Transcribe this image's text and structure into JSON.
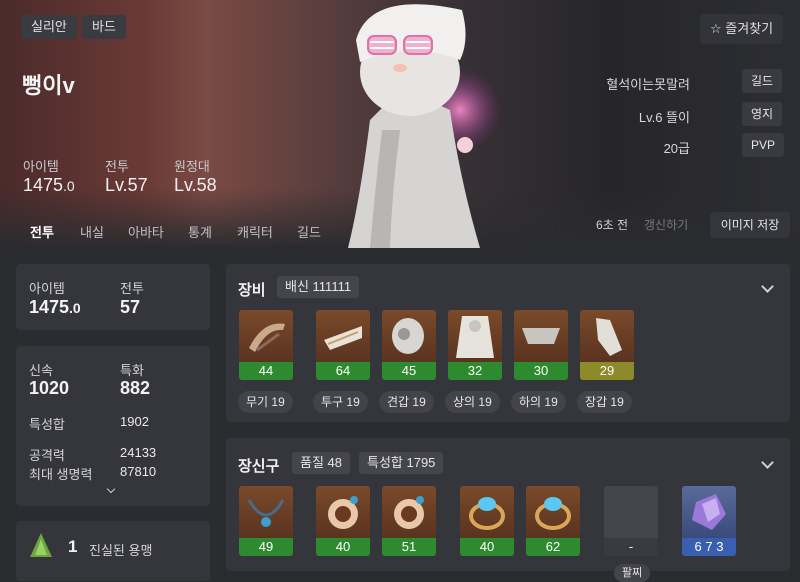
{
  "header": {
    "class_tag": "실리안",
    "class_tag2": "바드",
    "name": "뻥이v",
    "stats": [
      {
        "label": "아이템",
        "value": "1475",
        "decimal": ".0"
      },
      {
        "label": "전투",
        "value": "Lv.57",
        "decimal": ""
      },
      {
        "label": "원정대",
        "value": "Lv.58",
        "decimal": ""
      }
    ],
    "favorite_label": "즐겨찾기",
    "guild_name": "혈석이는못말려",
    "guild_badge": "길드",
    "estate_name": "Lv.6 뜰이",
    "estate_badge": "영지",
    "pvp_rank": "20급",
    "pvp_badge": "PVP"
  },
  "tabs": [
    "전투",
    "내실",
    "아바타",
    "통계",
    "캐릭터",
    "길드"
  ],
  "refresh": {
    "time": "6초 전",
    "label": "갱신하기",
    "save_label": "이미지 저장"
  },
  "summary": {
    "item_label": "아이템",
    "item_value": "1475",
    "item_decimal": ".0",
    "combat_label": "전투",
    "combat_value": "57"
  },
  "attributes": {
    "swift_label": "신속",
    "swift_value": "1020",
    "crit_label": "특화",
    "crit_value": "882",
    "sum_label": "특성합",
    "sum_value": "1902",
    "atk_label": "공격력",
    "atk_value": "24133",
    "hp_label": "최대 생명력",
    "hp_value": "87810"
  },
  "engraving": {
    "count": "1",
    "name": "진실된 용맹"
  },
  "equipment": {
    "title": "장비",
    "badge": "배신 111111",
    "items": [
      {
        "icon": "weapon-icon",
        "quality": "44",
        "label": "무기 19"
      },
      {
        "icon": "helmet-icon",
        "quality": "64",
        "label": "투구 19"
      },
      {
        "icon": "shoulder-icon",
        "quality": "45",
        "label": "견갑 19"
      },
      {
        "icon": "chest-icon",
        "quality": "32",
        "label": "상의 19"
      },
      {
        "icon": "pants-icon",
        "quality": "30",
        "label": "하의 19"
      },
      {
        "icon": "gloves-icon",
        "quality": "29",
        "label": "장갑 19"
      }
    ]
  },
  "accessories": {
    "title": "장신구",
    "badge1": "품질 48",
    "badge2": "특성합 1795",
    "items": [
      {
        "icon": "necklace-icon",
        "quality": "49"
      },
      {
        "icon": "earring-icon",
        "quality": "40"
      },
      {
        "icon": "earring-icon",
        "quality": "51"
      },
      {
        "icon": "ring-icon",
        "quality": "40"
      },
      {
        "icon": "ring-icon",
        "quality": "62"
      },
      {
        "icon": "empty-slot",
        "quality": "-"
      },
      {
        "icon": "stone-icon",
        "quality": "6 7 3"
      }
    ],
    "partial_label": "팔찌"
  },
  "colors": {
    "accent_green": "#2e8a2e",
    "accent_yellow": "#8d8a2b",
    "accent_blue": "#3b5fb0"
  }
}
